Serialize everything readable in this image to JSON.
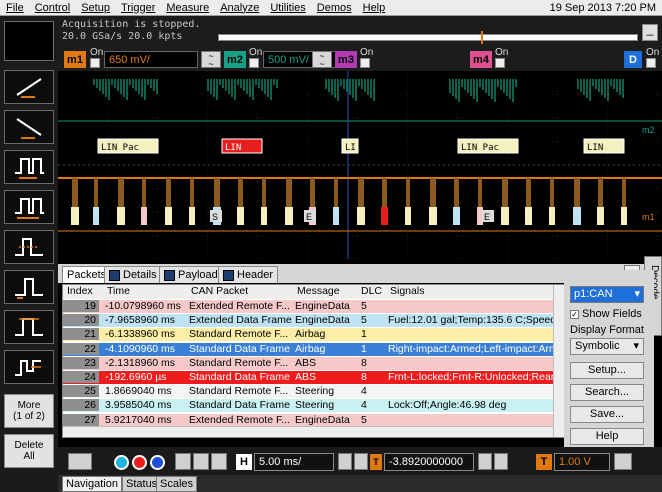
{
  "menu": {
    "items": [
      "File",
      "Control",
      "Setup",
      "Trigger",
      "Measure",
      "Analyze",
      "Utilities",
      "Demos",
      "Help"
    ],
    "datetime": "19 Sep 2013  7:20 PM"
  },
  "acquisition": {
    "status": "Acquisition is stopped.",
    "rate": "20.0 GSa/s   20.0 kpts"
  },
  "channels": [
    {
      "label": "m1",
      "on": "On",
      "value": "650 mV/",
      "color": "#e07a10"
    },
    {
      "label": "m2",
      "on": "On",
      "value": "500 mV/",
      "color": "#16a085"
    },
    {
      "label": "m3",
      "on": "On",
      "color": "#b23bb2"
    },
    {
      "label": "m4",
      "on": "On",
      "color": "#e05090"
    },
    {
      "label": "D",
      "on": "On",
      "color": "#1e6fd9"
    }
  ],
  "waveform": {
    "lin_labels": [
      "LIN Pac",
      "LIN",
      "LI",
      "LIN Pac",
      "LIN"
    ],
    "can_letters": [
      "S",
      "E",
      "E"
    ],
    "marker_m2": "m2",
    "marker_m1": "m1"
  },
  "tabs": [
    "Packets",
    "Details",
    "Payload",
    "Header"
  ],
  "table": {
    "headers": [
      "Index",
      "Time",
      "CAN Packet",
      "Message",
      "DLC",
      "Signals"
    ],
    "rows": [
      {
        "index": "19",
        "time": "-10.0798960 ms",
        "packet": "Extended Remote F...",
        "message": "EngineData",
        "dlc": "5",
        "signals": "",
        "bg": "#f6c9c9"
      },
      {
        "index": "20",
        "time": "-7.9658960 ms",
        "packet": "Extended Data Frame",
        "message": "EngineData",
        "dlc": "5",
        "signals": "Fuel:12.01 gal;Temp:135.6 C;Speed:...",
        "bg": "#bfe3f3"
      },
      {
        "index": "21",
        "time": "-6.1338960 ms",
        "packet": "Standard Remote F...",
        "message": "Airbag",
        "dlc": "1",
        "signals": "",
        "bg": "#fbeea6"
      },
      {
        "index": "22",
        "time": "-4.1090960 ms",
        "packet": "Standard Data Frame",
        "message": "Airbag",
        "dlc": "1",
        "signals": "Right-impact:Armed;Left-impact:Arm...",
        "bg": "#3a7fd6"
      },
      {
        "index": "23",
        "time": "-2.1318960 ms",
        "packet": "Standard Remote F...",
        "message": "ABS",
        "dlc": "8",
        "signals": "",
        "bg": "#f6c9c9"
      },
      {
        "index": "24",
        "time": "-192.6960 µs",
        "packet": "Standard Data Frame",
        "message": "ABS",
        "dlc": "8",
        "signals": "Frnt-L:locked;Frnt-R:Unlocked;Rear-L...",
        "bg": "#ee1c1c"
      },
      {
        "index": "25",
        "time": "1.8669040 ms",
        "packet": "Standard Remote F...",
        "message": "Steering",
        "dlc": "4",
        "signals": "",
        "bg": "#f4f4f4"
      },
      {
        "index": "26",
        "time": "3.9585040 ms",
        "packet": "Standard Data Frame",
        "message": "Steering",
        "dlc": "4",
        "signals": "Lock:Off;Angle:46.98 deg",
        "bg": "#c9f1f1"
      },
      {
        "index": "27",
        "time": "5.9217040 ms",
        "packet": "Extended Remote F...",
        "message": "EngineData",
        "dlc": "5",
        "signals": "",
        "bg": "#f6c9c9"
      }
    ]
  },
  "right_panel": {
    "decode_select": "p1:CAN",
    "show_fields": "Show Fields",
    "display_format_label": "Display Format",
    "display_format": "Symbolic",
    "setup": "Setup...",
    "search": "Search...",
    "save": "Save...",
    "help": "Help",
    "decode_tab": "Decode"
  },
  "left": {
    "more": "More",
    "more_sub": "(1 of 2)",
    "delete": "Delete",
    "delete_sub": "All"
  },
  "bottom": {
    "timebase": "5.00 ms/",
    "delay": "-3.8920000000 ms",
    "trigger_level": "1.00 V",
    "h_label": "H",
    "t_label": "T",
    "tabs": [
      "Navigation",
      "Status",
      "Scales"
    ]
  }
}
